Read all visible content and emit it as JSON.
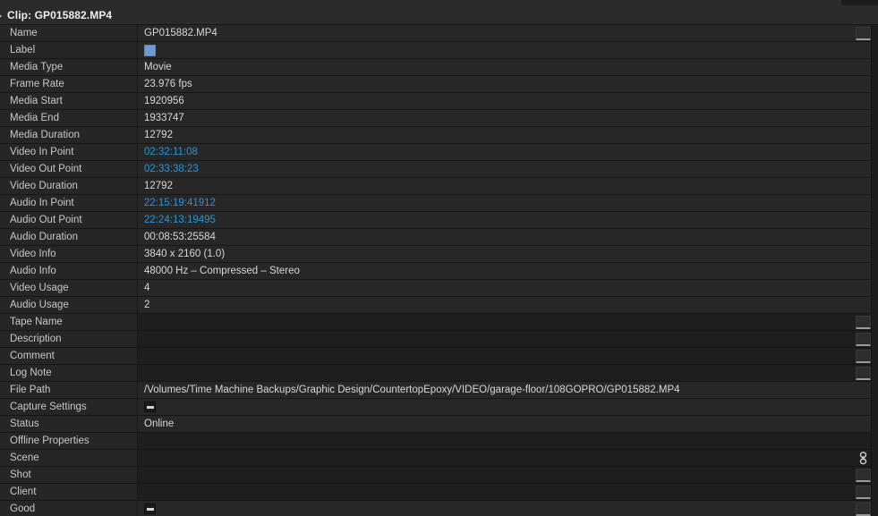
{
  "header": {
    "prefix": "Clip:",
    "clip_name": "GP015882.MP4",
    "disclosure_icon": "triangle-right-icon"
  },
  "colors": {
    "timecode_blue": "#2f93d4",
    "label_swatch": "#6f9bd1",
    "panel_bg": "#232323",
    "row_name_bg": "#262626",
    "row_value_bg": "#272727",
    "empty_value_bg": "#1e1e1e"
  },
  "rows": [
    {
      "name": "Name",
      "value": "GP015882.MP4",
      "type": "text",
      "side": "field-button"
    },
    {
      "name": "Label",
      "value": "",
      "type": "swatch",
      "side": "none"
    },
    {
      "name": "Media Type",
      "value": "Movie",
      "type": "text",
      "side": "none"
    },
    {
      "name": "Frame Rate",
      "value": "23.976 fps",
      "type": "text",
      "side": "none"
    },
    {
      "name": "Media Start",
      "value": "1920956",
      "type": "text",
      "side": "none"
    },
    {
      "name": "Media End",
      "value": "1933747",
      "type": "text",
      "side": "none"
    },
    {
      "name": "Media Duration",
      "value": "12792",
      "type": "text",
      "side": "none"
    },
    {
      "name": "Video In Point",
      "value": "02:32:11:08",
      "type": "timecode",
      "side": "none"
    },
    {
      "name": "Video Out Point",
      "value": "02:33:38:23",
      "type": "timecode",
      "side": "none"
    },
    {
      "name": "Video Duration",
      "value": "12792",
      "type": "text",
      "side": "none"
    },
    {
      "name": "Audio In Point",
      "value": "22:15:19:41912",
      "type": "timecode",
      "side": "none"
    },
    {
      "name": "Audio Out Point",
      "value": "22:24:13:19495",
      "type": "timecode",
      "side": "none"
    },
    {
      "name": "Audio Duration",
      "value": "00:08:53:25584",
      "type": "text",
      "side": "none"
    },
    {
      "name": "Video Info",
      "value": "3840 x 2160 (1.0)",
      "type": "text",
      "side": "none"
    },
    {
      "name": "Audio Info",
      "value": "48000 Hz – Compressed – Stereo",
      "type": "text",
      "side": "none"
    },
    {
      "name": "Video Usage",
      "value": "4",
      "type": "text",
      "side": "none"
    },
    {
      "name": "Audio Usage",
      "value": "2",
      "type": "text",
      "side": "none"
    },
    {
      "name": "Tape Name",
      "value": "",
      "type": "empty",
      "side": "field-button"
    },
    {
      "name": "Description",
      "value": "",
      "type": "empty",
      "side": "field-button"
    },
    {
      "name": "Comment",
      "value": "",
      "type": "empty",
      "side": "field-button"
    },
    {
      "name": "Log Note",
      "value": "",
      "type": "empty",
      "side": "field-button"
    },
    {
      "name": "File Path",
      "value": "/Volumes/Time Machine Backups/Graphic Design/CountertopEpoxy/VIDEO/garage-floor/108GOPRO/GP015882.MP4",
      "type": "text",
      "side": "none"
    },
    {
      "name": "Capture Settings",
      "value": "",
      "type": "checkbox",
      "side": "none"
    },
    {
      "name": "Status",
      "value": "Online",
      "type": "text",
      "side": "none"
    },
    {
      "name": "Offline Properties",
      "value": "",
      "type": "empty",
      "side": "none"
    },
    {
      "name": "Scene",
      "value": "",
      "type": "empty",
      "side": "link-icon"
    },
    {
      "name": "Shot",
      "value": "",
      "type": "empty",
      "side": "field-button"
    },
    {
      "name": "Client",
      "value": "",
      "type": "empty",
      "side": "field-button"
    },
    {
      "name": "Good",
      "value": "",
      "type": "checkbox",
      "side": "field-button"
    }
  ]
}
